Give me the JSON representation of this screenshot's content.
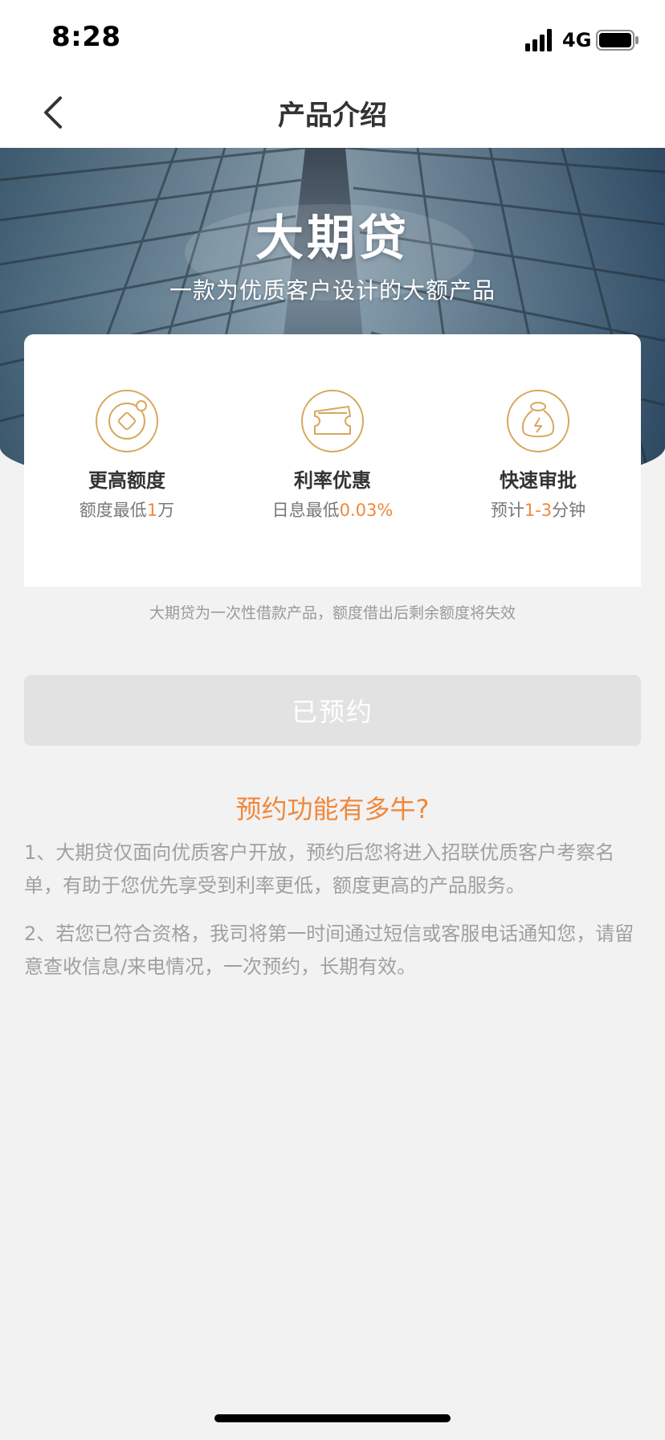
{
  "status_bar": {
    "time": "8:28",
    "network": "4G",
    "icons": [
      "signal-icon",
      "battery-icon"
    ]
  },
  "nav": {
    "title": "产品介绍",
    "back_icon": "chevron-left-icon"
  },
  "hero": {
    "title": "大期贷",
    "subtitle": "一款为优质客户设计的大额产品"
  },
  "features": [
    {
      "icon": "coin-icon",
      "title": "更高额度",
      "desc_prefix": "额度最低",
      "desc_highlight": "1",
      "desc_suffix": "万"
    },
    {
      "icon": "ticket-icon",
      "title": "利率优惠",
      "desc_prefix": "日息最低",
      "desc_highlight": "0.03%",
      "desc_suffix": ""
    },
    {
      "icon": "money-bag-icon",
      "title": "快速审批",
      "desc_prefix": "预计",
      "desc_highlight": "1-3",
      "desc_suffix": "分钟"
    }
  ],
  "note": "大期贷为一次性借款产品，额度借出后剩余额度将失效",
  "reserve_button": {
    "label": "已预约",
    "state": "disabled"
  },
  "faq": {
    "title": "预约功能有多牛?",
    "items": [
      "1、大期贷仅面向优质客户开放，预约后您将进入招联优质客户考察名单，有助于您优先享受到利率更低，额度更高的产品服务。",
      "2、若您已符合资格，我司将第一时间通过短信或客服电话通知您，请留意查收信息/来电情况，一次预约，长期有效。"
    ]
  },
  "colors": {
    "accent": "#f0883a",
    "gold": "#d7a85c",
    "background": "#f2f2f2",
    "button_disabled": "#e2e2e2",
    "muted_text": "#a0a0a0"
  }
}
